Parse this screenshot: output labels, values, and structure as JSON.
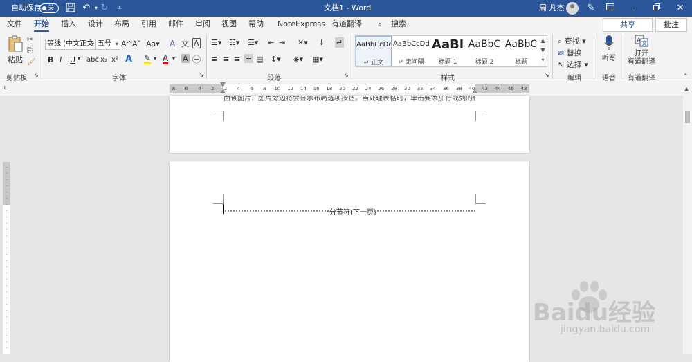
{
  "titlebar": {
    "autosave_label": "自动保存",
    "autosave_state": "关",
    "doc_title": "文档1 - Word",
    "user_name": "周 凡杰"
  },
  "tabs": [
    "文件",
    "开始",
    "插入",
    "设计",
    "布局",
    "引用",
    "邮件",
    "审阅",
    "视图",
    "帮助",
    "NoteExpress",
    "有道翻译"
  ],
  "active_tab": "开始",
  "search_label": "搜索",
  "share_label": "共享",
  "comment_label": "批注",
  "ribbon": {
    "clipboard": {
      "paste": "粘贴",
      "group": "剪贴板"
    },
    "font": {
      "font_name": "等线 (中文正文",
      "font_size": "五号",
      "group": "字体",
      "buttons": [
        "B",
        "I",
        "U",
        "abc",
        "x₂",
        "x²"
      ]
    },
    "paragraph": {
      "group": "段落"
    },
    "styles": {
      "group": "样式",
      "items": [
        {
          "preview": "AaBbCcDd",
          "name": "↵ 正文"
        },
        {
          "preview": "AaBbCcDd",
          "name": "↵ 无间隔"
        },
        {
          "preview": "AaBl",
          "name": "标题 1"
        },
        {
          "preview": "AaBbC",
          "name": "标题 2"
        },
        {
          "preview": "AaBbC",
          "name": "标题"
        }
      ]
    },
    "editing": {
      "find": "查找",
      "replace": "替换",
      "select": "选择",
      "group": "编辑"
    },
    "voice": {
      "dictate": "听写",
      "group": "语音"
    },
    "youdao": {
      "open": "打开",
      "open2": "有道翻译",
      "group": "有道翻译"
    }
  },
  "ruler": {
    "ticks": [
      "8",
      "6",
      "4",
      "2",
      "2",
      "4",
      "6",
      "8",
      "10",
      "12",
      "14",
      "16",
      "18",
      "20",
      "22",
      "24",
      "26",
      "28",
      "30",
      "32",
      "34",
      "36",
      "38",
      "40",
      "42",
      "44",
      "46",
      "48"
    ]
  },
  "document": {
    "page1_cut_text": "面该图片，图片旁边将会显示布局选项按钮。当处理表格时，单击要添加行或列的位置，然",
    "section_break": "分节符(下一页)"
  },
  "watermark": {
    "main": "Baidu经验",
    "sub": "jingyan.baidu.com"
  }
}
